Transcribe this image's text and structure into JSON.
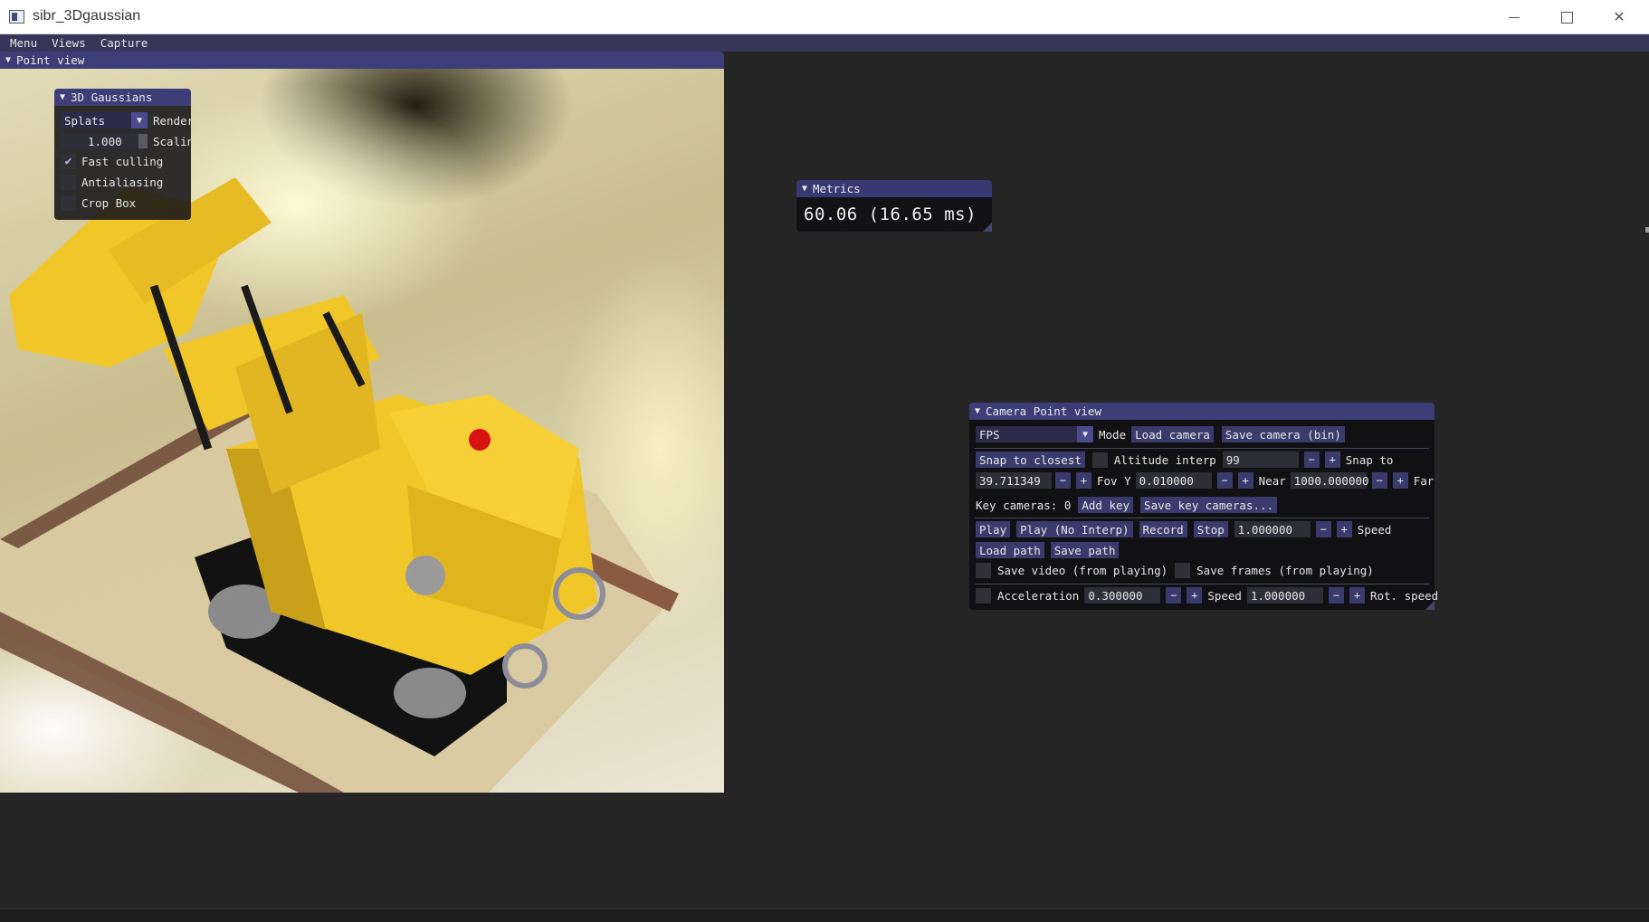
{
  "window": {
    "title": "sibr_3Dgaussian",
    "minimize_icon": "minimize-icon",
    "maximize_icon": "maximize-icon",
    "close_symbol": "✕"
  },
  "menubar": {
    "items": [
      "Menu",
      "Views",
      "Capture"
    ]
  },
  "point_view": {
    "title": "Point view"
  },
  "gaussians": {
    "title": "3D Gaussians",
    "render_mode": "Splats",
    "render_label": "Render",
    "scaling_value": "1.000",
    "scaling_label": "Scaling",
    "fast_culling": {
      "label": "Fast culling",
      "checked": true
    },
    "antialiasing": {
      "label": "Antialiasing",
      "checked": false
    },
    "crop_box": {
      "label": "Crop Box",
      "checked": false
    }
  },
  "metrics": {
    "title": "Metrics",
    "value": "60.06 (16.65 ms)"
  },
  "camera": {
    "title": "Camera Point view",
    "mode_value": "FPS",
    "mode_label": "Mode",
    "load_camera": "Load camera",
    "save_camera": "Save camera (bin)",
    "snap_to_closest": "Snap to closest",
    "altitude_label": "Altitude interp",
    "altitude_value": "99",
    "snap_to_label": "Snap to",
    "fovy_value": "39.711349",
    "fovy_label": "Fov Y",
    "near_value": "0.010000",
    "near_label": "Near",
    "far_value": "1000.000000",
    "far_label": "Far",
    "key_cameras_label": "Key cameras: 0",
    "add_key": "Add key",
    "save_key_cameras": "Save key cameras...",
    "play": "Play",
    "play_no_interp": "Play (No Interp)",
    "record": "Record",
    "stop": "Stop",
    "speed_value": "1.000000",
    "speed_label": "Speed",
    "load_path": "Load path",
    "save_path": "Save path",
    "save_video": "Save video (from playing)",
    "save_frames": "Save frames (from playing)",
    "acceleration_label": "Acceleration",
    "acceleration_value": "0.300000",
    "move_speed_label": "Speed",
    "move_speed_value": "1.000000",
    "rot_speed_label": "Rot. speed",
    "minus": "−",
    "plus": "+"
  },
  "colors": {
    "menubar": "#363659",
    "header": "#3d3d77",
    "button": "#3a3a6c",
    "background": "#252525"
  }
}
